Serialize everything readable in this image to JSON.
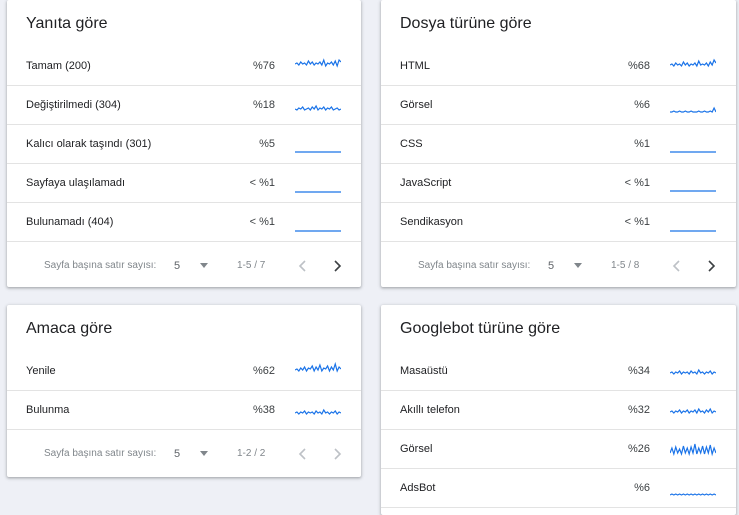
{
  "cards": [
    {
      "title": "Yanıta göre",
      "rows": [
        {
          "label": "Tamam (200)",
          "pct": "%76",
          "spark": [
            8,
            7,
            9,
            6,
            8,
            7,
            9,
            5,
            8,
            6,
            9,
            7,
            8,
            6,
            9,
            4,
            10,
            7,
            8,
            6,
            9,
            5,
            10,
            4,
            6
          ]
        },
        {
          "label": "Değiştirilmedi (304)",
          "pct": "%18",
          "spark": [
            14,
            15,
            13,
            14,
            12,
            15,
            14,
            13,
            15,
            12,
            14,
            11,
            15,
            13,
            14,
            12,
            15,
            13,
            14,
            12,
            15,
            14,
            13,
            15,
            14
          ]
        },
        {
          "label": "Kalıcı olarak taşındı (301)",
          "pct": "%5",
          "spark": [
            18,
            18,
            18,
            18,
            18,
            18,
            18,
            18,
            18,
            18,
            18,
            18,
            18,
            18,
            18,
            18,
            18,
            18,
            18,
            18,
            18,
            18,
            18,
            18,
            18
          ]
        },
        {
          "label": "Sayfaya ulaşılamadı",
          "pct": "< %1",
          "spark": [
            19,
            19,
            19,
            19,
            19,
            19,
            19,
            19,
            19,
            19,
            19,
            19,
            19,
            19,
            19,
            19,
            19,
            19,
            19,
            19,
            19,
            19,
            19,
            19,
            19
          ]
        },
        {
          "label": "Bulunamadı (404)",
          "pct": "< %1",
          "spark": [
            19,
            19,
            19,
            19,
            19,
            19,
            19,
            19,
            19,
            19,
            19,
            19,
            19,
            19,
            19,
            19,
            19,
            19,
            19,
            19,
            19,
            19,
            19,
            19,
            19
          ]
        }
      ],
      "pager": {
        "rows_label": "Sayfa başına satır sayısı:",
        "rows_value": "5",
        "range": "1-5 / 7"
      }
    },
    {
      "title": "Dosya türüne göre",
      "rows": [
        {
          "label": "HTML",
          "pct": "%68",
          "spark": [
            9,
            8,
            10,
            7,
            9,
            8,
            10,
            6,
            9,
            7,
            10,
            8,
            9,
            7,
            10,
            5,
            9,
            8,
            9,
            7,
            10,
            6,
            9,
            4,
            7
          ]
        },
        {
          "label": "Görsel",
          "pct": "%6",
          "spark": [
            17,
            17,
            16,
            17,
            17,
            16,
            17,
            17,
            16,
            17,
            17,
            16,
            17,
            17,
            17,
            16,
            17,
            17,
            16,
            17,
            17,
            16,
            17,
            13,
            17
          ]
        },
        {
          "label": "CSS",
          "pct": "%1",
          "spark": [
            18,
            18,
            18,
            18,
            18,
            18,
            18,
            18,
            18,
            18,
            18,
            18,
            18,
            18,
            18,
            18,
            18,
            18,
            18,
            18,
            18,
            18,
            18,
            18,
            18
          ]
        },
        {
          "label": "JavaScript",
          "pct": "< %1",
          "spark": [
            18,
            18,
            18,
            18,
            18,
            18,
            18,
            18,
            18,
            18,
            18,
            18,
            18,
            18,
            18,
            18,
            18,
            18,
            18,
            18,
            18,
            18,
            18,
            18,
            18
          ]
        },
        {
          "label": "Sendikasyon",
          "pct": "< %1",
          "spark": [
            19,
            19,
            19,
            19,
            19,
            19,
            19,
            19,
            19,
            19,
            19,
            19,
            19,
            19,
            19,
            19,
            19,
            19,
            19,
            19,
            19,
            19,
            19,
            19,
            19
          ]
        }
      ],
      "pager": {
        "rows_label": "Sayfa başına satır sayısı:",
        "rows_value": "5",
        "range": "1-5 / 8"
      }
    },
    {
      "title": "Amaca göre",
      "rows": [
        {
          "label": "Yenile",
          "pct": "%62",
          "spark": [
            9,
            8,
            10,
            7,
            9,
            6,
            10,
            7,
            8,
            5,
            10,
            6,
            9,
            4,
            10,
            7,
            8,
            5,
            10,
            6,
            9,
            3,
            10,
            6,
            8
          ]
        },
        {
          "label": "Bulunma",
          "pct": "%38",
          "spark": [
            13,
            12,
            14,
            12,
            13,
            11,
            14,
            12,
            13,
            12,
            14,
            11,
            13,
            12,
            14,
            10,
            13,
            12,
            14,
            12,
            13,
            11,
            14,
            12,
            13
          ]
        }
      ],
      "pager": {
        "rows_label": "Sayfa başına satır sayısı:",
        "rows_value": "5",
        "range": "1-2 / 2"
      }
    },
    {
      "title": "Googlebot türüne göre",
      "rows": [
        {
          "label": "Masaüstü",
          "pct": "%34",
          "spark": [
            12,
            11,
            13,
            11,
            12,
            10,
            13,
            11,
            12,
            11,
            13,
            10,
            12,
            11,
            13,
            9,
            12,
            11,
            13,
            11,
            12,
            10,
            13,
            11,
            12
          ]
        },
        {
          "label": "Akıllı telefon",
          "pct": "%32",
          "spark": [
            12,
            11,
            13,
            11,
            12,
            10,
            13,
            11,
            12,
            10,
            13,
            11,
            12,
            10,
            13,
            9,
            12,
            11,
            13,
            10,
            12,
            9,
            13,
            11,
            12
          ]
        },
        {
          "label": "Görsel",
          "pct": "%26",
          "spark": [
            14,
            9,
            15,
            8,
            14,
            10,
            15,
            7,
            14,
            9,
            15,
            8,
            14,
            5,
            15,
            9,
            14,
            7,
            15,
            8,
            14,
            6,
            15,
            9,
            14
          ]
        },
        {
          "label": "AdsBot",
          "pct": "%6",
          "spark": [
            17,
            16,
            17,
            16,
            17,
            16,
            17,
            16,
            17,
            16,
            17,
            16,
            17,
            16,
            17,
            16,
            17,
            16,
            17,
            16,
            17,
            16,
            17,
            16,
            17
          ]
        }
      ],
      "pager": null
    }
  ],
  "colors": {
    "spark": "#1a73e8"
  },
  "icons": {
    "dropdown": "caret-down-icon",
    "prev": "chevron-left-icon",
    "next": "chevron-right-icon"
  }
}
